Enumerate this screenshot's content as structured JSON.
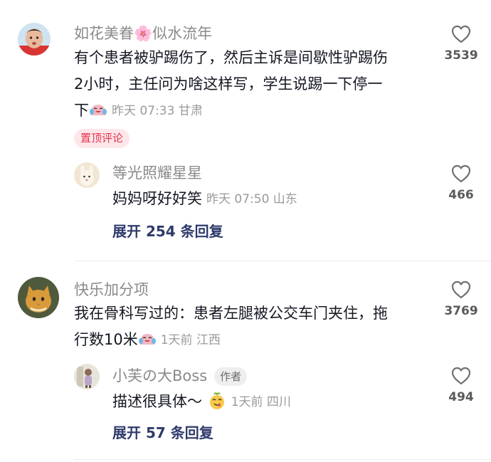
{
  "comments": [
    {
      "user": "如花美眷🌸似水流年",
      "text_line1": "有个患者被驴踢伤了，然后主诉是间歇性驴踢伤",
      "text_line2": "2小时，主任问为啥这样写，学生说踢一下停一",
      "text_line3": "下",
      "meta": "昨天 07:33 甘肃",
      "likes": "3539",
      "pinned_label": "置顶评论",
      "reply": {
        "user": "等光照耀星星",
        "text": "妈妈呀好好笑",
        "meta": "昨天 07:50 山东",
        "likes": "466"
      },
      "expand_label": "展开 254 条回复"
    },
    {
      "user": "快乐加分项",
      "text_line1": "我在骨科写过的：患者左腿被公交车门夹住，拖",
      "text_line2": "行数10米",
      "meta": "1天前 江西",
      "likes": "3769",
      "reply": {
        "user": "小芙の大Boss",
        "author_tag": "作者",
        "text": "描述很具体～",
        "meta": "1天前 四川",
        "likes": "494"
      },
      "expand_label": "展开 57 条回复"
    }
  ],
  "colors": {
    "text": "#161823",
    "nickname": "#8a8a8a",
    "meta": "#9a9a9a",
    "pinned_bg": "#fde7ea",
    "pinned_text": "#e8334f",
    "expand_link": "#2f3a6b"
  },
  "icons": {
    "like": "heart-outline-icon",
    "laugh_cry": "laugh-cry-emoji-icon",
    "cheeky": "cheeky-emoji-icon"
  }
}
